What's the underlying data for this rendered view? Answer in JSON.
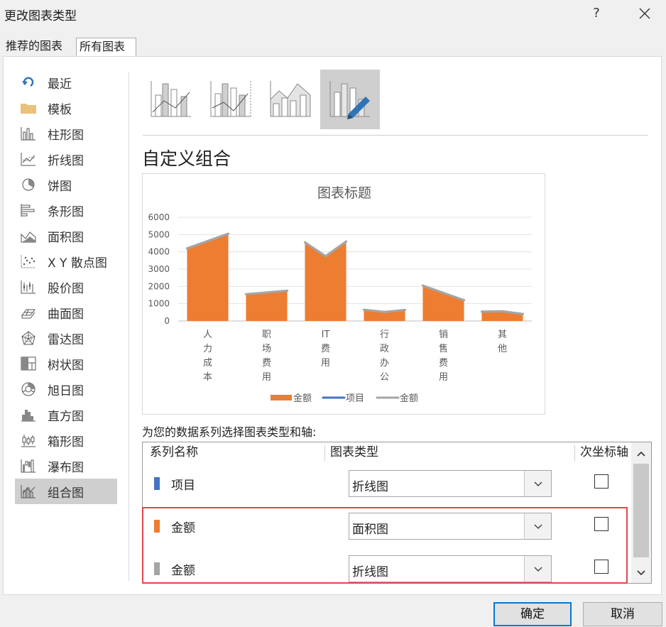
{
  "window": {
    "title": "更改图表类型",
    "help": "?"
  },
  "tabs": [
    {
      "label": "推荐的图表"
    },
    {
      "label": "所有图表"
    }
  ],
  "sidebar": {
    "items": [
      {
        "label": "最近",
        "icon": "undo-arrow-icon"
      },
      {
        "label": "模板",
        "icon": "folder-icon"
      },
      {
        "label": "柱形图",
        "icon": "column-chart-icon"
      },
      {
        "label": "折线图",
        "icon": "line-chart-icon"
      },
      {
        "label": "饼图",
        "icon": "pie-chart-icon"
      },
      {
        "label": "条形图",
        "icon": "bar-chart-icon"
      },
      {
        "label": "面积图",
        "icon": "area-chart-icon"
      },
      {
        "label": "X Y 散点图",
        "icon": "scatter-chart-icon"
      },
      {
        "label": "股价图",
        "icon": "stock-chart-icon"
      },
      {
        "label": "曲面图",
        "icon": "surface-chart-icon"
      },
      {
        "label": "雷达图",
        "icon": "radar-chart-icon"
      },
      {
        "label": "树状图",
        "icon": "treemap-chart-icon"
      },
      {
        "label": "旭日图",
        "icon": "sunburst-chart-icon"
      },
      {
        "label": "直方图",
        "icon": "histogram-chart-icon"
      },
      {
        "label": "箱形图",
        "icon": "box-whisker-chart-icon"
      },
      {
        "label": "瀑布图",
        "icon": "waterfall-chart-icon"
      },
      {
        "label": "组合图",
        "icon": "combo-chart-icon"
      }
    ],
    "active_index": 16
  },
  "main": {
    "section_title": "自定义组合",
    "series_caption": "为您的数据系列选择图表类型和轴:"
  },
  "colors": {
    "orange": "#ed7d31",
    "blue": "#4472c4",
    "gray": "#a5a5a5",
    "highlight": "#e0474c",
    "accent": "#0078d7"
  },
  "chart_data": {
    "type": "area",
    "title": "图表标题",
    "categories": [
      "人力成本",
      "职场费用",
      "IT费用",
      "行政办公",
      "销售费用",
      "其他"
    ],
    "category_labels": [
      [
        "人",
        "力",
        "成",
        "本"
      ],
      [
        "职",
        "场",
        "费",
        "用"
      ],
      [
        "IT",
        "费",
        "用"
      ],
      [
        "行",
        "政",
        "办",
        "公"
      ],
      [
        "销",
        "售",
        "费",
        "用"
      ],
      [
        "其",
        "他"
      ]
    ],
    "yticks": [
      "6000",
      "5000",
      "4000",
      "3000",
      "2000",
      "1000",
      "0"
    ],
    "ylim": [
      0,
      6000
    ],
    "grid": true,
    "legend_position": "bottom",
    "points_x": [
      [
        0.15,
        0.85
      ],
      [
        1.15,
        1.85
      ],
      [
        2.15,
        2.5,
        2.85
      ],
      [
        3.15,
        3.5,
        3.85
      ],
      [
        4.15,
        4.85
      ],
      [
        5.15,
        5.5,
        5.85
      ]
    ],
    "series": [
      {
        "name": "金额",
        "type": "area",
        "color": "#ed7d31",
        "values": [
          [
            4200,
            5050
          ],
          [
            1550,
            1750
          ],
          [
            4550,
            3750,
            4600
          ],
          [
            650,
            520,
            640
          ],
          [
            2050,
            1200
          ],
          [
            540,
            560,
            400
          ]
        ]
      },
      {
        "name": "项目",
        "type": "line",
        "color": "#4472c4",
        "values": []
      },
      {
        "name": "金额",
        "type": "line",
        "color": "#a5a5a5",
        "values": [
          [
            4200,
            5050
          ],
          [
            1550,
            1750
          ],
          [
            4550,
            3750,
            4600
          ],
          [
            650,
            520,
            640
          ],
          [
            2050,
            1200
          ],
          [
            540,
            560,
            400
          ]
        ]
      }
    ]
  },
  "grid": {
    "headers": [
      "系列名称",
      "图表类型",
      "次坐标轴"
    ],
    "rows": [
      {
        "name": "项目",
        "chart_type": "折线图",
        "color": "#4472c4",
        "secondary_axis": false
      },
      {
        "name": "金额",
        "chart_type": "面积图",
        "color": "#ed7d31",
        "secondary_axis": false
      },
      {
        "name": "金额",
        "chart_type": "折线图",
        "color": "#a5a5a5",
        "secondary_axis": false
      }
    ]
  },
  "buttons": {
    "ok": "确定",
    "cancel": "取消"
  }
}
